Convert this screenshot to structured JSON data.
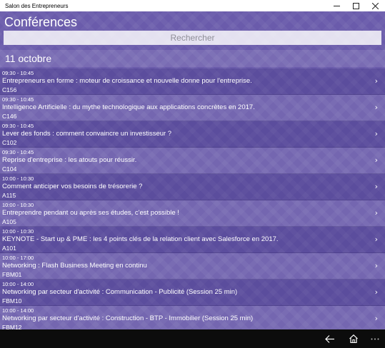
{
  "window": {
    "title": "Salon des Entrepreneurs"
  },
  "page": {
    "title": "Conférences",
    "search_placeholder": "Rechercher",
    "date_header": "11 octobre"
  },
  "sessions": [
    {
      "time": "09:30 - 10:45",
      "title": "Entrepreneurs en forme : moteur de croissance et nouvelle donne pour l'entreprise.",
      "room": "C156"
    },
    {
      "time": "09:30 - 10:45",
      "title": "Intelligence Artificielle : du mythe technologique aux applications concrètes en 2017.",
      "room": "C146"
    },
    {
      "time": "09:30 - 10:45",
      "title": "Lever des fonds : comment convaincre un investisseur ?",
      "room": "C102"
    },
    {
      "time": "09:30 - 10:45",
      "title": "Reprise d'entreprise : les atouts pour réussir.",
      "room": "C104"
    },
    {
      "time": "10:00 - 10:30",
      "title": "Comment anticiper vos besoins de trésorerie ?",
      "room": "A115"
    },
    {
      "time": "10:00 - 10:30",
      "title": "Entreprendre pendant ou après ses études, c'est possible !",
      "room": "A105"
    },
    {
      "time": "10:00 - 10:30",
      "title": "KEYNOTE - Start up & PME : les 4 points clés de la relation client avec Salesforce en 2017.",
      "room": "A101"
    },
    {
      "time": "10:00 - 17:00",
      "title": "Networking : Flash Business Meeting en continu",
      "room": "FBM01"
    },
    {
      "time": "10:00 - 14:00",
      "title": "Networking par secteur d'activité : Communication - Publicité (Session 25 min)",
      "room": "FBM10"
    },
    {
      "time": "10:00 - 14:00",
      "title": "Networking par secteur d'activité : Construction - BTP - Immobilier (Session 25 min)",
      "room": "FBM12"
    }
  ],
  "icons": {
    "minimize": "minimize-icon",
    "maximize": "maximize-icon",
    "close": "close-icon",
    "chevron": "chevron-right-icon",
    "back": "back-arrow-icon",
    "home": "home-icon",
    "more": "more-icon"
  },
  "colors": {
    "background": "#6a5bab",
    "taskbar": "#0c0c0c"
  }
}
